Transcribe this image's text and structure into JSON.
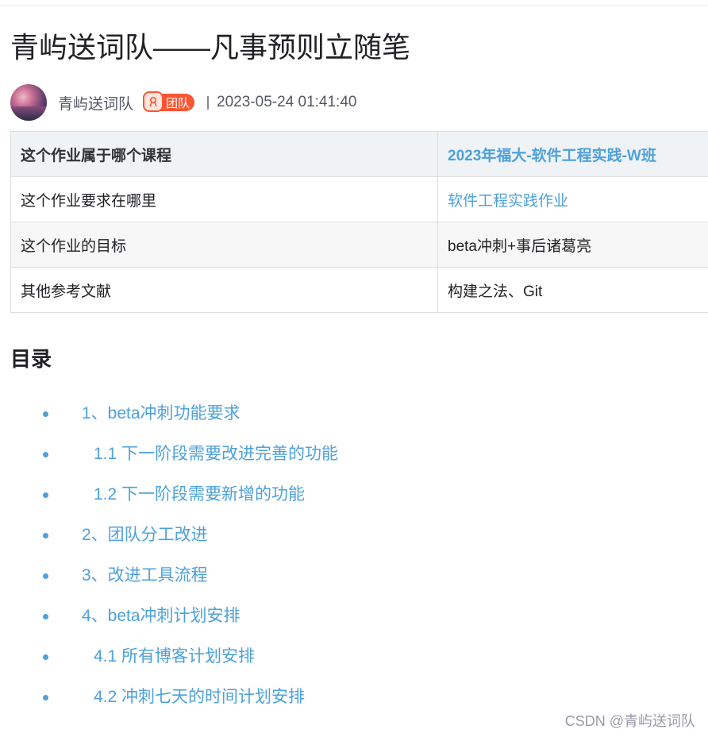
{
  "article": {
    "title": "青屿送词队——凡事预则立随笔",
    "author": "青屿送词队",
    "team_badge": "团队",
    "datetime": "2023-05-24 01:41:40"
  },
  "info_table": {
    "header": {
      "label": "这个作业属于哪个课程",
      "value": "2023年福大-软件工程实践-W班"
    },
    "rows": [
      {
        "label": "这个作业要求在哪里",
        "value": "软件工程实践作业",
        "is_link": true
      },
      {
        "label": "这个作业的目标",
        "value": "beta冲刺+事后诸葛亮",
        "is_link": false
      },
      {
        "label": "其他参考文献",
        "value": "构建之法、Git",
        "is_link": false
      }
    ]
  },
  "toc": {
    "title": "目录",
    "items": [
      {
        "label": "1、beta冲刺功能要求",
        "level": 1
      },
      {
        "label": "1.1 下一阶段需要改进完善的功能",
        "level": 2
      },
      {
        "label": "1.2 下一阶段需要新增的功能",
        "level": 2
      },
      {
        "label": "2、团队分工改进",
        "level": 1
      },
      {
        "label": "3、改进工具流程",
        "level": 1
      },
      {
        "label": "4、beta冲刺计划安排",
        "level": 1
      },
      {
        "label": "4.1 所有博客计划安排",
        "level": 2
      },
      {
        "label": "4.2 冲刺七天的时间计划安排",
        "level": 2
      }
    ]
  },
  "watermark": "CSDN @青屿送词队",
  "colors": {
    "link": "#4ea1db",
    "badge": "#fc5531",
    "table_header_bg": "#eff3f6"
  },
  "icons": {
    "team_badge": "team-badge-icon"
  }
}
